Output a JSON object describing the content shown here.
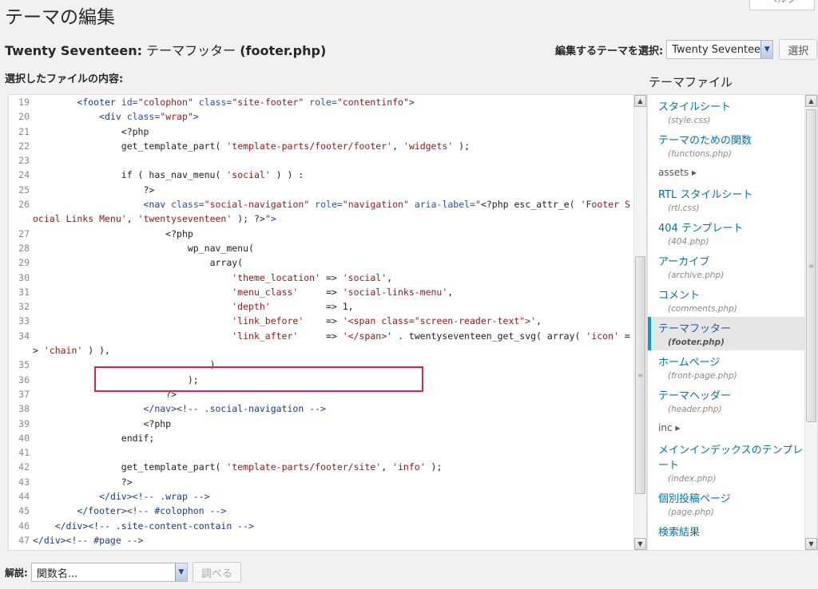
{
  "help_tab": "ヘルプ",
  "page_title": "テーマの編集",
  "file_heading": {
    "theme": "Twenty Seventeen:",
    "file": "テーマフッター",
    "filename": "(footer.php)"
  },
  "theme_select": {
    "label": "編集するテーマを選択:",
    "value": "Twenty Seventeen",
    "button": "選択"
  },
  "selected_file_label": "選択したファイルの内容:",
  "code_lines": [
    {
      "n": "19",
      "html": "        <span class=\"tag\">&lt;footer</span> <span class=\"attr\">id=</span><span class=\"str\">\"colophon\"</span> <span class=\"attr\">class=</span><span class=\"str\">\"site-footer\"</span> <span class=\"attr\">role=</span><span class=\"str\">\"contentinfo\"</span><span class=\"tag\">&gt;</span>"
    },
    {
      "n": "20",
      "html": "            <span class=\"tag\">&lt;div</span> <span class=\"attr\">class=</span><span class=\"str\">\"wrap\"</span><span class=\"tag\">&gt;</span>"
    },
    {
      "n": "21",
      "html": "                &lt;?php"
    },
    {
      "n": "22",
      "html": "                get_template_part( <span class=\"str\">'template-parts/footer/footer'</span>, <span class=\"str\">'widgets'</span> );"
    },
    {
      "n": "23",
      "html": ""
    },
    {
      "n": "24",
      "html": "                if ( has_nav_menu( <span class=\"str\">'social'</span> ) ) :"
    },
    {
      "n": "25",
      "html": "                    ?&gt;"
    },
    {
      "n": "26",
      "html": "                    <span class=\"tag\">&lt;nav</span> <span class=\"attr\">class=</span><span class=\"str\">\"social-navigation\"</span> <span class=\"attr\">role=</span><span class=\"str\">\"navigation\"</span> <span class=\"attr\">aria-label=</span><span class=\"str\">\"</span>&lt;?php esc_attr_e( <span class=\"str\">'Footer Social Links Menu'</span>, <span class=\"str\">'twentyseventeen'</span> ); ?&gt;<span class=\"str\">\"</span><span class=\"tag\">&gt;</span>"
    },
    {
      "n": "27",
      "html": "                        &lt;?php"
    },
    {
      "n": "28",
      "html": "                            wp_nav_menu("
    },
    {
      "n": "29",
      "html": "                                array("
    },
    {
      "n": "30",
      "html": "                                    <span class=\"str\">'theme_location'</span> =&gt; <span class=\"str\">'social'</span>,"
    },
    {
      "n": "31",
      "html": "                                    <span class=\"str\">'menu_class'</span>     =&gt; <span class=\"str\">'social-links-menu'</span>,"
    },
    {
      "n": "32",
      "html": "                                    <span class=\"str\">'depth'</span>          =&gt; 1,"
    },
    {
      "n": "33",
      "html": "                                    <span class=\"str\">'link_before'</span>    =&gt; <span class=\"str\">'&lt;span class=\"screen-reader-text\"&gt;'</span>,"
    },
    {
      "n": "34",
      "html": "                                    <span class=\"str\">'link_after'</span>     =&gt; <span class=\"str\">'&lt;/span&gt;'</span> . twentyseventeen_get_svg( array( <span class=\"str\">'icon'</span> =&gt; <span class=\"str\">'chain'</span> ) ),"
    },
    {
      "n": "35",
      "html": "                                )"
    },
    {
      "n": "36",
      "html": "                            );"
    },
    {
      "n": "37",
      "html": "                        ?&gt;"
    },
    {
      "n": "38",
      "html": "                    <span class=\"tag\">&lt;/nav&gt;</span><span class=\"tag\">&lt;!-- .social-navigation --&gt;</span>"
    },
    {
      "n": "39",
      "html": "                    &lt;?php"
    },
    {
      "n": "40",
      "html": "                endif;"
    },
    {
      "n": "41",
      "html": ""
    },
    {
      "n": "42",
      "html": "                get_template_part( <span class=\"str\">'template-parts/footer/site'</span>, <span class=\"str\">'info'</span> );"
    },
    {
      "n": "43",
      "html": "                ?&gt;"
    },
    {
      "n": "44",
      "html": "            <span class=\"tag\">&lt;/div&gt;</span><span class=\"tag\">&lt;!-- .wrap --&gt;</span>"
    },
    {
      "n": "45",
      "html": "        <span class=\"tag\">&lt;/footer&gt;</span><span class=\"tag\">&lt;!-- #colophon --&gt;</span>"
    },
    {
      "n": "46",
      "html": "    <span class=\"tag\">&lt;/div&gt;</span><span class=\"tag\">&lt;!-- .site-content-contain --&gt;</span>"
    },
    {
      "n": "47",
      "html": "<span class=\"tag\">&lt;/div&gt;</span><span class=\"tag\">&lt;!-- #page --&gt;</span>"
    }
  ],
  "sidebar": {
    "title": "テーマファイル",
    "items": [
      {
        "type": "file",
        "name": "スタイルシート",
        "path": "(style.css)"
      },
      {
        "type": "file",
        "name": "テーマのための関数",
        "path": "(functions.php)"
      },
      {
        "type": "folder",
        "name": "assets ▸"
      },
      {
        "type": "file",
        "name": "RTL スタイルシート",
        "path": "(rtl.css)"
      },
      {
        "type": "file",
        "name": "404 テンプレート",
        "path": "(404.php)"
      },
      {
        "type": "file",
        "name": "アーカイブ",
        "path": "(archive.php)"
      },
      {
        "type": "file",
        "name": "コメント",
        "path": "(comments.php)"
      },
      {
        "type": "file",
        "name": "テーマフッター",
        "path": "(footer.php)",
        "active": true
      },
      {
        "type": "file",
        "name": "ホームページ",
        "path": "(front-page.php)"
      },
      {
        "type": "file",
        "name": "テーマヘッダー",
        "path": "(header.php)"
      },
      {
        "type": "folder",
        "name": "inc ▸"
      },
      {
        "type": "file",
        "name": "メインインデックスのテンプレート",
        "path": "(index.php)"
      },
      {
        "type": "file",
        "name": "個別投稿ページ",
        "path": "(page.php)"
      },
      {
        "type": "file",
        "name": "検索結果",
        "path": ""
      }
    ]
  },
  "doc": {
    "label": "解説:",
    "placeholder": "関数名...",
    "button": "調べる"
  }
}
